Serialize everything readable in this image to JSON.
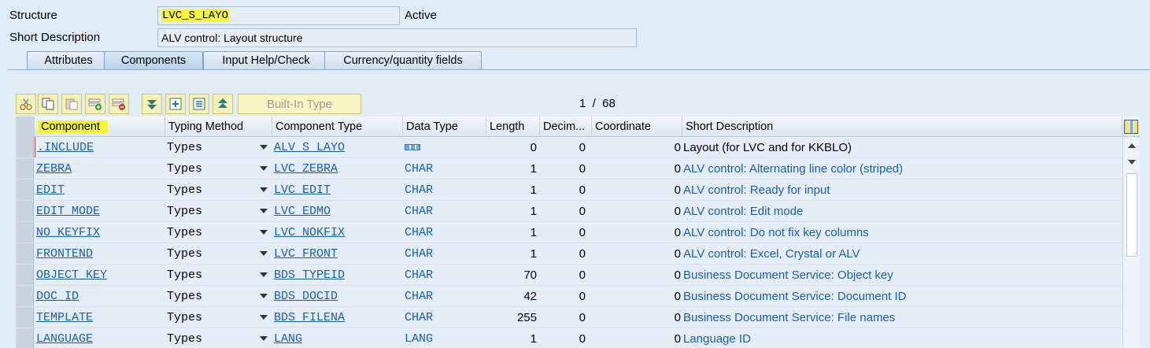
{
  "header": {
    "structure_label": "Structure",
    "structure_value": "LVC_S_LAYO",
    "status": "Active",
    "short_desc_label": "Short Description",
    "short_desc_value": "ALV control: Layout structure"
  },
  "tabs": [
    {
      "label": "Attributes",
      "active": false
    },
    {
      "label": "Components",
      "active": true
    },
    {
      "label": "Input Help/Check",
      "active": false
    },
    {
      "label": "Currency/quantity fields",
      "active": false
    }
  ],
  "toolbar": {
    "icons": [
      "cut-icon",
      "copy-icon",
      "paste-icon",
      "insert-row-icon",
      "delete-row-icon",
      "first-page-icon",
      "prev-page-icon",
      "next-page-icon",
      "last-page-icon"
    ],
    "builtin_type_label": "Built-In Type",
    "pager": "1  /  68"
  },
  "columns": [
    "Component",
    "Typing Method",
    "Component Type",
    "Data Type",
    "Length",
    "Decim...",
    "Coordinate",
    "Short Description"
  ],
  "rows": [
    {
      "component": ".INCLUDE",
      "typing": "Types",
      "ctype": "ALV_S_LAYO",
      "dtype": "",
      "length": "0",
      "dec": "0",
      "coord": "0",
      "desc": "Layout (for LVC and for KKBLO)"
    },
    {
      "component": "ZEBRA",
      "typing": "Types",
      "ctype": "LVC_ZEBRA",
      "dtype": "CHAR",
      "length": "1",
      "dec": "0",
      "coord": "0",
      "desc": "ALV control: Alternating line color (striped)"
    },
    {
      "component": "EDIT",
      "typing": "Types",
      "ctype": "LVC_EDIT",
      "dtype": "CHAR",
      "length": "1",
      "dec": "0",
      "coord": "0",
      "desc": "ALV control: Ready for input"
    },
    {
      "component": "EDIT_MODE",
      "typing": "Types",
      "ctype": "LVC_EDMO",
      "dtype": "CHAR",
      "length": "1",
      "dec": "0",
      "coord": "0",
      "desc": "ALV control: Edit mode"
    },
    {
      "component": "NO_KEYFIX",
      "typing": "Types",
      "ctype": "LVC_NOKFIX",
      "dtype": "CHAR",
      "length": "1",
      "dec": "0",
      "coord": "0",
      "desc": "ALV control: Do not fix key columns"
    },
    {
      "component": "FRONTEND",
      "typing": "Types",
      "ctype": "LVC_FRONT",
      "dtype": "CHAR",
      "length": "1",
      "dec": "0",
      "coord": "0",
      "desc": "ALV control: Excel, Crystal or ALV"
    },
    {
      "component": "OBJECT_KEY",
      "typing": "Types",
      "ctype": "BDS_TYPEID",
      "dtype": "CHAR",
      "length": "70",
      "dec": "0",
      "coord": "0",
      "desc": "Business Document Service: Object key"
    },
    {
      "component": "DOC_ID",
      "typing": "Types",
      "ctype": "BDS_DOCID",
      "dtype": "CHAR",
      "length": "42",
      "dec": "0",
      "coord": "0",
      "desc": "Business Document Service: Document ID"
    },
    {
      "component": "TEMPLATE",
      "typing": "Types",
      "ctype": "BDS_FILENA",
      "dtype": "CHAR",
      "length": "255",
      "dec": "0",
      "coord": "0",
      "desc": "Business Document Service: File names"
    },
    {
      "component": "LANGUAGE",
      "typing": "Types",
      "ctype": "LANG",
      "dtype": "LANG",
      "length": "1",
      "dec": "0",
      "coord": "0",
      "desc": "Language ID"
    }
  ],
  "colors": {
    "highlight": "#f4f43a",
    "link": "#1a5fa8",
    "toolbar_bg": "#f5f1b8"
  }
}
